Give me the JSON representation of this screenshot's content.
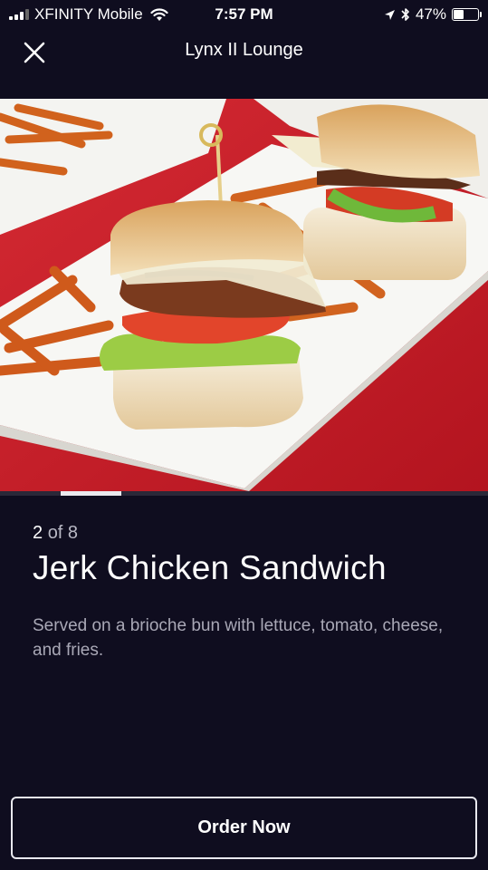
{
  "status_bar": {
    "carrier": "XFINITY Mobile",
    "time": "7:57 PM",
    "battery_percent_label": "47%",
    "battery_level": 0.47
  },
  "nav": {
    "title": "Lynx II Lounge",
    "close_icon": "close-icon"
  },
  "gallery": {
    "current": "2",
    "of_label": "of 8",
    "current_index": 2,
    "total": 8
  },
  "item": {
    "title": "Jerk Chicken Sandwich",
    "description": "Served on a brioche bun with lettuce, tomato, cheese, and fries."
  },
  "actions": {
    "order_label": "Order Now"
  },
  "colors": {
    "background": "#0f0d1f",
    "tablecloth": "#c8202c",
    "button_border": "#e8e8ee"
  }
}
